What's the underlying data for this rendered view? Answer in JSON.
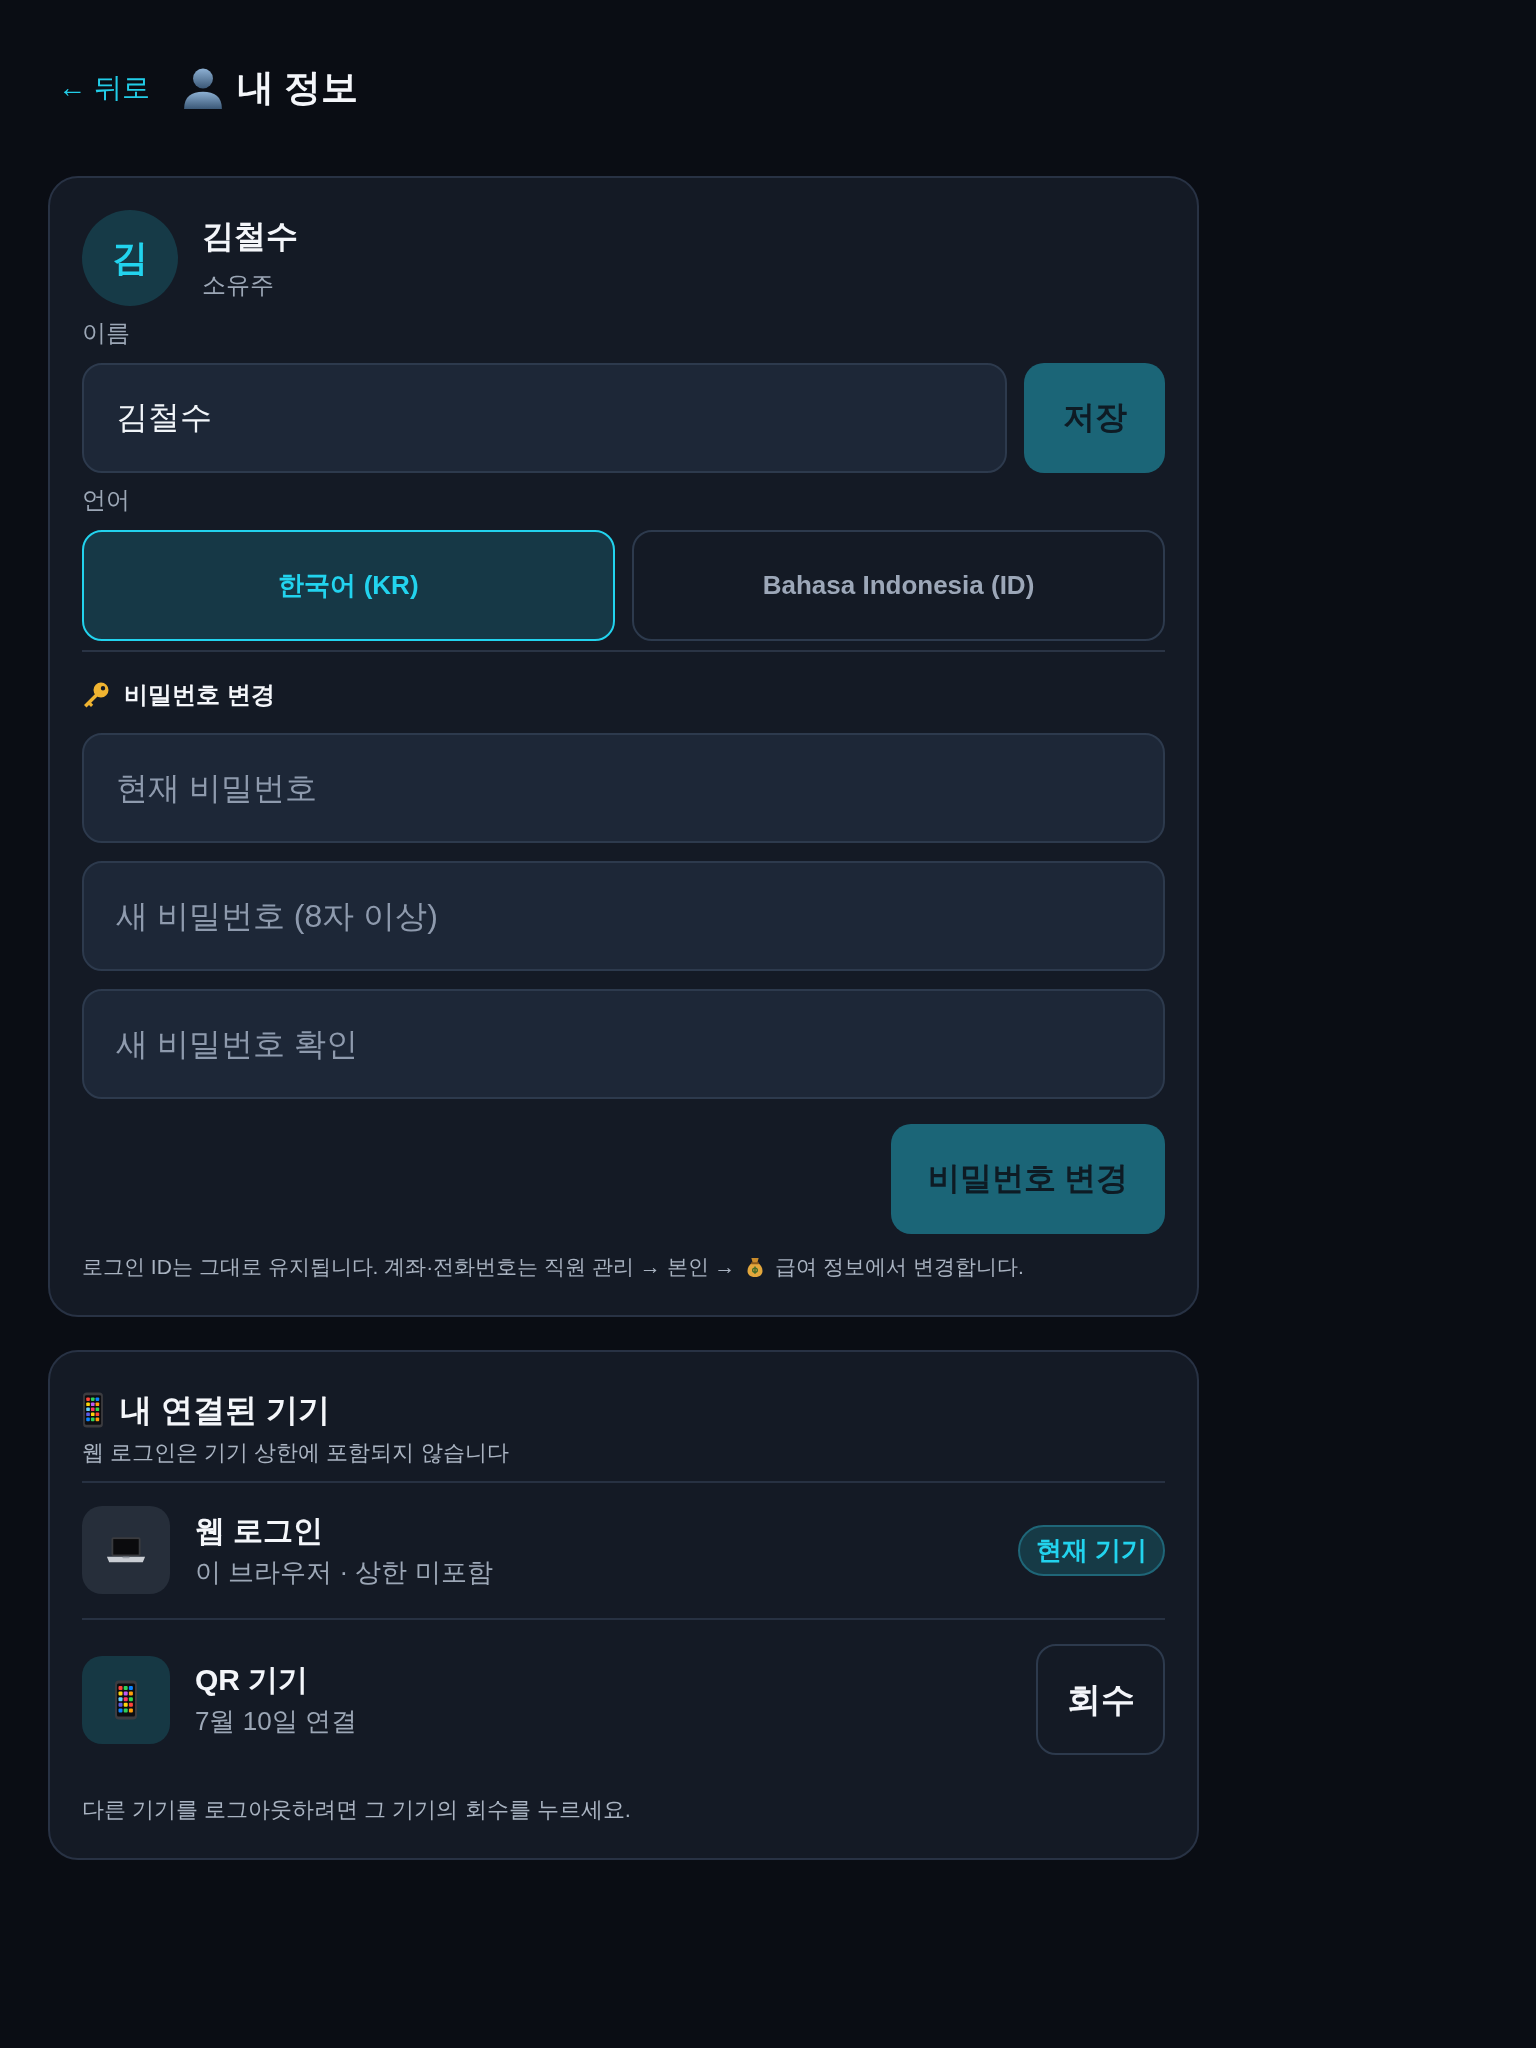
{
  "header": {
    "back_link": "← 뒤로",
    "title": "내 정보"
  },
  "profile": {
    "avatar_initial": "김",
    "name": "김철수",
    "role": "소유주"
  },
  "name_field": {
    "label": "이름",
    "value": "김철수",
    "save_button": "저장"
  },
  "language": {
    "label": "언어",
    "options": [
      {
        "label": "한국어 (KR)",
        "selected": true
      },
      {
        "label": "Bahasa Indonesia (ID)",
        "selected": false
      }
    ]
  },
  "password": {
    "heading": "비밀번호 변경",
    "fields": [
      {
        "placeholder": "현재 비밀번호"
      },
      {
        "placeholder": "새 비밀번호 (8자 이상)"
      },
      {
        "placeholder": "새 비밀번호 확인"
      }
    ],
    "submit_button": "비밀번호 변경"
  },
  "note": [
    "로그인 ID는 그대로 유지됩니다. 계좌·전화번호는 직원 관리 → 본인 →",
    "급여 정보에서 변경합니다."
  ],
  "devices": {
    "heading": "내 연결된 기기",
    "subtitle": "웹 로그인은 기기 상한에 포함되지 않습니다",
    "items": [
      {
        "kind": "web",
        "name": "웹 로그인",
        "detail": "이 브라우저 · 상한 미포함",
        "badge": "현재 기기"
      },
      {
        "kind": "qr",
        "name": "QR 기기",
        "detail": "7월 10일 연결",
        "action": "회수"
      }
    ],
    "footer": "다른 기기를 로그아웃하려면 그 기기의 회수를 누르세요."
  }
}
